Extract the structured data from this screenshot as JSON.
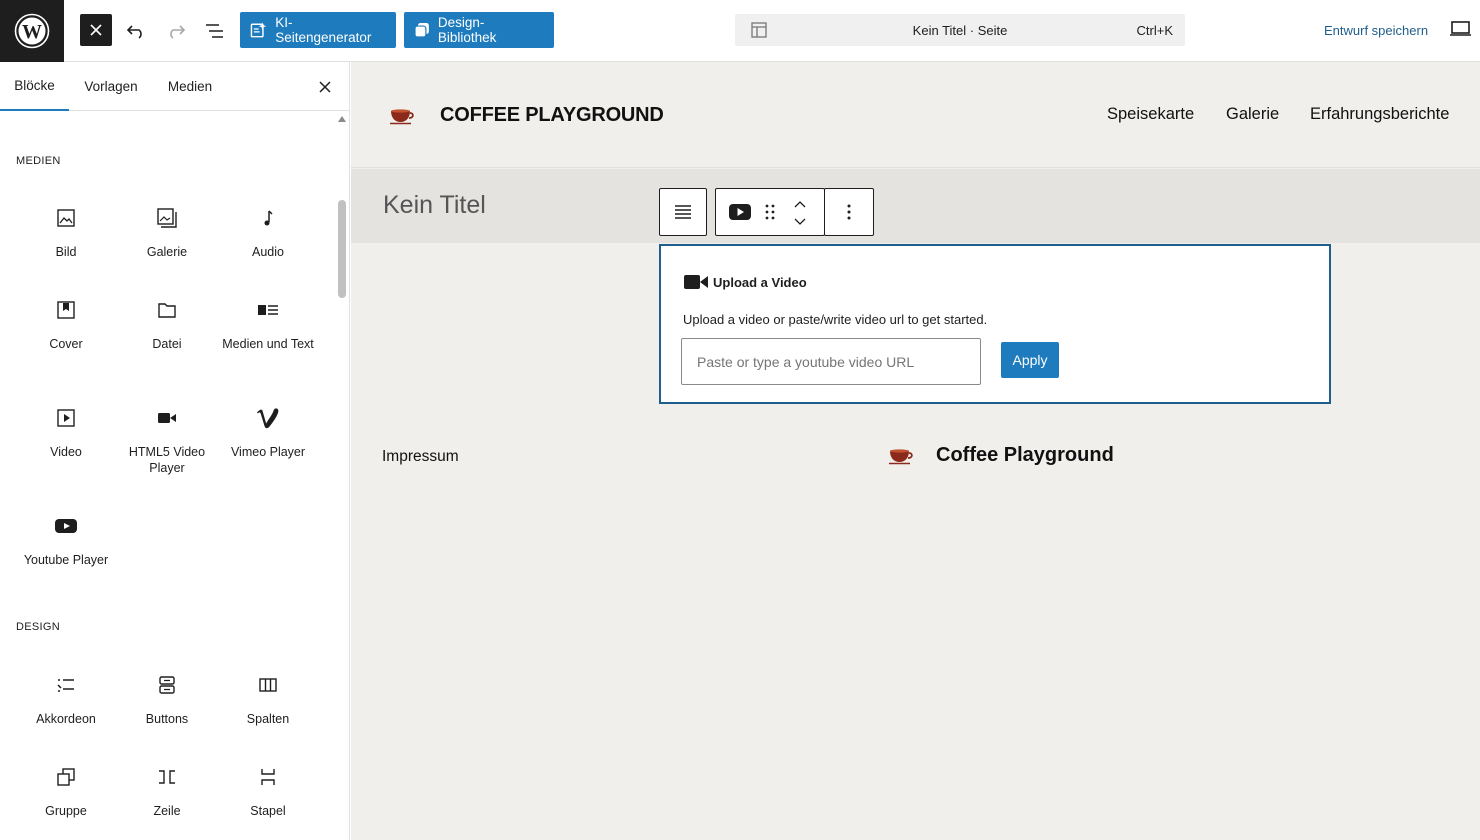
{
  "topbar": {
    "close_label": "close-inserter",
    "ai_generator_label": "KI-Seitengenerator",
    "design_library_label": "Design-Bibliothek",
    "document_title": "Kein Titel · Seite",
    "shortcut": "Ctrl+K",
    "save_draft_label": "Entwurf speichern"
  },
  "sidebar": {
    "tabs": [
      {
        "label": "Blöcke",
        "active": true
      },
      {
        "label": "Vorlagen",
        "active": false
      },
      {
        "label": "Medien",
        "active": false
      }
    ],
    "sections": [
      {
        "title": "MEDIEN",
        "blocks": [
          {
            "label": "Bild",
            "icon": "image-icon"
          },
          {
            "label": "Galerie",
            "icon": "gallery-icon"
          },
          {
            "label": "Audio",
            "icon": "audio-icon"
          },
          {
            "label": "Cover",
            "icon": "cover-icon"
          },
          {
            "label": "Datei",
            "icon": "file-icon"
          },
          {
            "label": "Medien und Text",
            "icon": "media-text-icon"
          },
          {
            "label": "Video",
            "icon": "video-icon"
          },
          {
            "label": "HTML5 Video Player",
            "icon": "video-camera-icon"
          },
          {
            "label": "Vimeo Player",
            "icon": "vimeo-icon"
          },
          {
            "label": "Youtube Player",
            "icon": "youtube-icon"
          }
        ]
      },
      {
        "title": "DESIGN",
        "blocks": [
          {
            "label": "Akkordeon",
            "icon": "accordion-icon"
          },
          {
            "label": "Buttons",
            "icon": "buttons-icon"
          },
          {
            "label": "Spalten",
            "icon": "columns-icon"
          },
          {
            "label": "Gruppe",
            "icon": "group-icon"
          },
          {
            "label": "Zeile",
            "icon": "row-icon"
          },
          {
            "label": "Stapel",
            "icon": "stack-icon"
          }
        ]
      }
    ]
  },
  "canvas": {
    "site_title": "COFFEE PLAYGROUND",
    "nav": [
      "Speisekarte",
      "Galerie",
      "Erfahrungsberichte"
    ],
    "page_title": "Kein Titel",
    "video_block": {
      "heading": "Upload a Video",
      "description": "Upload a video or paste/write video url to get started.",
      "input_placeholder": "Paste or type a youtube video URL",
      "apply_label": "Apply"
    },
    "footer": {
      "link": "Impressum",
      "site_title": "Coffee Playground"
    }
  },
  "colors": {
    "accent": "#1e7bbd",
    "dark": "#1e1e1e",
    "canvas_bg": "#f1efec",
    "title_band": "#e5e3df",
    "cup": "#8b2a1a"
  }
}
